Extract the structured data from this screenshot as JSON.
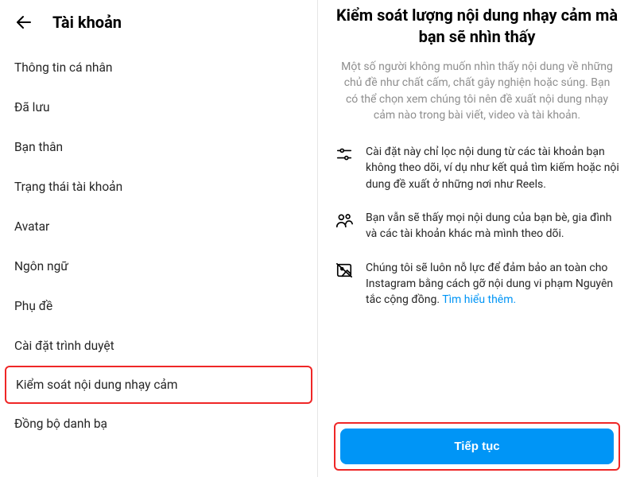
{
  "left": {
    "title": "Tài khoản",
    "items": [
      "Thông tin cá nhân",
      "Đã lưu",
      "Bạn thân",
      "Trạng thái tài khoản",
      "Avatar",
      "Ngôn ngữ",
      "Phụ đề",
      "Cài đặt trình duyệt",
      "Kiểm soát nội dung nhạy cảm",
      "Đồng bộ danh bạ"
    ],
    "highlightIndex": 8
  },
  "right": {
    "title": "Kiểm soát lượng nội dung nhạy cảm mà bạn sẽ nhìn thấy",
    "subtitle": "Một số người không muốn nhìn thấy nội dung về những chủ đề như chất cấm, chất gây nghiện hoặc súng. Bạn có thể chọn xem chúng tôi nên đề xuất nội dung nhạy cảm nào trong bài viết, video và tài khoản.",
    "features": [
      {
        "icon": "sliders",
        "text": "Cài đặt này chỉ lọc nội dung từ các tài khoản bạn không theo dõi, ví dụ như kết quả tìm kiếm hoặc nội dung đề xuất ở những nơi như Reels."
      },
      {
        "icon": "people",
        "text": "Bạn vẫn sẽ thấy mọi nội dung của bạn bè, gia đình và các tài khoản khác mà mình theo dõi."
      },
      {
        "icon": "shield-image",
        "text": "Chúng tôi sẽ luôn nỗ lực để đảm bảo an toàn cho Instagram bằng cách gỡ nội dung vi phạm Nguyên tắc cộng đồng. ",
        "link": "Tìm hiểu thêm."
      }
    ],
    "continueLabel": "Tiếp tục"
  }
}
